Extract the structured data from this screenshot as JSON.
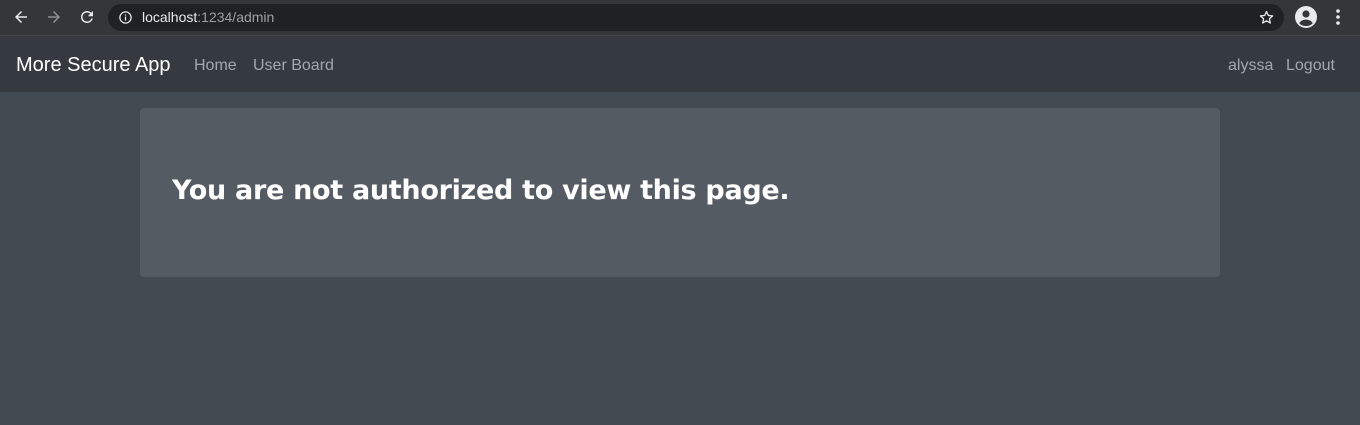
{
  "browser": {
    "url_host": "localhost",
    "url_path": ":1234/admin",
    "icons": {
      "back": "arrow-left-icon",
      "forward": "arrow-right-icon",
      "reload": "reload-icon",
      "info": "info-icon",
      "bookmark": "star-icon",
      "profile": "account-circle-icon",
      "menu": "kebab-menu-icon"
    }
  },
  "navbar": {
    "brand": "More Secure App",
    "links": {
      "home": "Home",
      "user_board": "User Board"
    },
    "right": {
      "username": "alyssa",
      "logout": "Logout"
    }
  },
  "main": {
    "message": "You are not authorized to view this page."
  },
  "colors": {
    "page_background": "#434a52",
    "navbar_background": "#343a40",
    "jumbotron_background": "#545b63",
    "browser_chrome": "#35363a",
    "omnibox": "#202124"
  }
}
